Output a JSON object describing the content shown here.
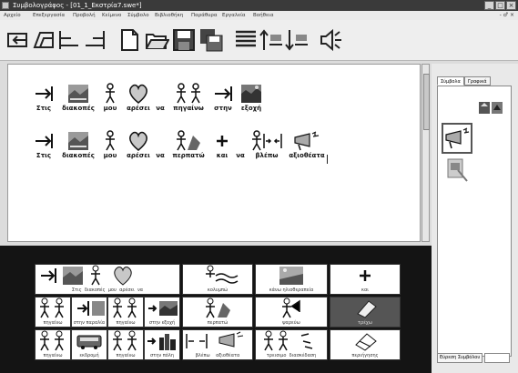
{
  "window": {
    "title": "Συμβολογράφος - [01_1_Εκστρία7.swe*]",
    "controls": [
      "_",
      "□",
      "×"
    ]
  },
  "menu": {
    "items": [
      "Αρχείο",
      "Επεξεργασία",
      "Προβολή",
      "Κείμενο",
      "Σύμβολο",
      "Βιβλιοθήκη",
      "Παράθυρα",
      "Εργαλεία",
      "Βοήθεια"
    ],
    "right_controls": "- ♂ ×"
  },
  "toolbar": {
    "buttons": [
      "indent-left-icon",
      "indent-right-icon",
      "align-left-icon",
      "align-right-icon",
      "new-document-icon",
      "open-folder-icon",
      "save-icon",
      "save-as-icon",
      "justify-icon",
      "insert-above-icon",
      "insert-below-icon",
      "speaker-icon"
    ]
  },
  "document": {
    "line1": [
      "Στις",
      "διακοπές",
      "μου",
      "αρέσει",
      "να",
      "πηγαίνω",
      "στην",
      "εξοχή"
    ],
    "line2": [
      "Στις",
      "διακοπές",
      "μου",
      "αρέσει",
      "να",
      "περπατώ",
      "και",
      "να",
      "βλέπω",
      "αξιοθέατα"
    ]
  },
  "panel": {
    "tabs": [
      "Σύμβολα",
      "Γραφικά"
    ],
    "search_label": "Εύρεση Συμβόλου",
    "search_value": ""
  },
  "grid": {
    "labels": [
      "Στις",
      "διακοπές",
      "μου",
      "αρέσει",
      "να",
      "κολυμπώ",
      "κάνω ηλιοθεραπεία",
      "και",
      "πηγαίνω",
      "στην",
      "παραλία",
      "πηγαίνω",
      "στην",
      "εξοχή",
      "περπατώ",
      "ψαρεύω",
      "τρέχω",
      "πηγαίνω",
      "εκδρομή",
      "πηγαίνω",
      "στην",
      "πόλη",
      "βλέπω",
      "αξιοθέατα",
      "τρεισιμο",
      "διασκέδαση",
      "περιήγησης"
    ]
  }
}
